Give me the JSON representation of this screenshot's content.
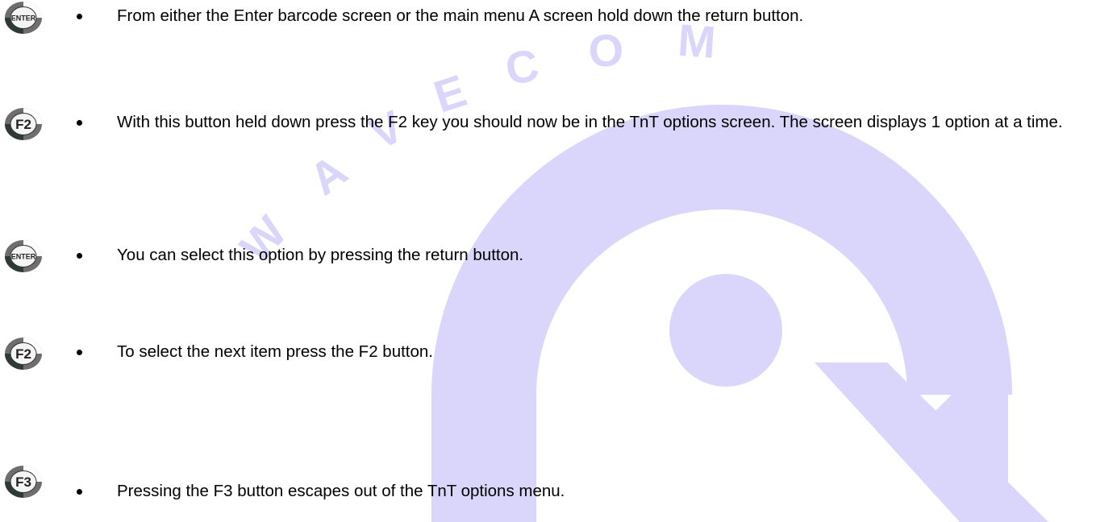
{
  "watermark": {
    "text": "WAVECOM",
    "color": "#d9d5fb"
  },
  "instructions": [
    {
      "key": "ENTER",
      "icon": "enter-key-icon",
      "text": "From either the Enter barcode screen or the main menu A screen hold down the return button."
    },
    {
      "key": "F2",
      "icon": "f2-key-icon",
      "text": "With this button held down press the F2 key you should now be in the TnT options screen. The screen displays 1 option at a time."
    },
    {
      "key": "ENTER",
      "icon": "enter-key-icon",
      "text": "You can select this option by pressing the return button."
    },
    {
      "key": "F2",
      "icon": "f2-key-icon",
      "text": "To select the next item press the F2 button."
    },
    {
      "key": "F3",
      "icon": "f3-key-icon",
      "text": "Pressing the F3 button escapes out of the TnT options menu."
    }
  ]
}
